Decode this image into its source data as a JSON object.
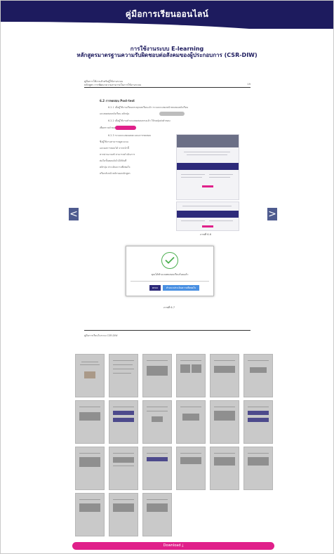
{
  "header": {
    "title": "คู่มือการเรียนออนไลน์"
  },
  "document": {
    "title_line1": "การใช้งานระบบ E-learning",
    "title_line2": "หลักสูตรมาตรฐานความรับผิดชอบต่อสังคมของผู้ประกอบการ (CSR-DIW)"
  },
  "page": {
    "header_line1": "คู่มือการใช้งานสำหรับผู้ใช้งานระบบ",
    "header_line2": "หลักสูตร การพัฒนาความสามารถในการใช้งานระบบ",
    "page_number": "19",
    "section_title": "6.2 การทดสอบ Post-test",
    "para1": "6.2.1 เมื่อผู้ใช้งานเรียนครบทุกบทเรียนแล้ว ระบบจะแสดงหน้าทดสอบหลังเรียน",
    "para1b": "แบบทดสอบหลังเรียน คลิกปุ่ม",
    "para2": "6.2.2 เมื่อผู้ใช้งานทำแบบทดสอบครบแล้ว ให้กดปุ่มส่งคำตอบ",
    "para2b": "เพื่อตรวจคำตอบ",
    "para3": "6.2.3 ระบบจะแสดงผลคะแนนการทดสอบ",
    "para3_lines": [
      "ซึ่งผู้ใช้งานสามารถดูคะแนน",
      "และผลการสอบได้ จากหน้านี้",
      "หากผ่านเกณฑ์ สามารถดำเนินการ",
      "ต่อในขั้นตอนถัดไปได้ทันที",
      "คลิกปุ่ม ประเมินความพึงพอใจ",
      "หรือกลับหน้าหลักของหลักสูตร"
    ],
    "figure1_caption": "ภาพที่ 6.6",
    "figure2_caption": "ภาพที่ 6.7",
    "footer": "คู่มือการเรียนในระบบ CSR-DIW",
    "dialog_text": "คุณได้ทำแบบทดสอบเรียบร้อยแล้ว",
    "dialog_btn_ok": "ตกลง",
    "dialog_btn_eval": "ทำแบบประเมินความพึงพอใจ"
  },
  "nav": {
    "prev_symbol": "<",
    "next_symbol": ">"
  },
  "download": {
    "label": "Download"
  },
  "colors": {
    "primary": "#1d1b5e",
    "accent": "#e0208a",
    "nav_button": "#4e5b8f"
  }
}
